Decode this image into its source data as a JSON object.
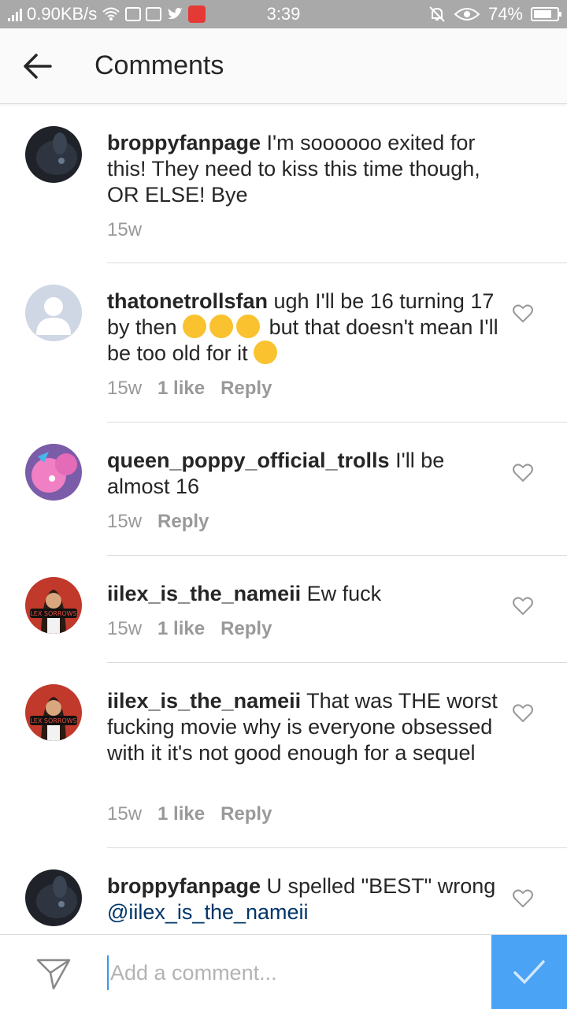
{
  "status_bar": {
    "speed": "0.90KB/s",
    "time": "3:39",
    "battery": "74%"
  },
  "header": {
    "title": "Comments"
  },
  "comments": [
    {
      "username": "broppyfanpage",
      "text": " I'm soooooo exited for this! They need to kiss this time though, OR ELSE! Bye",
      "age": "15w",
      "likes": "",
      "reply": ""
    },
    {
      "username": "thatonetrollsfan",
      "text_a": " ugh I'll be 16 turning 17 by then ",
      "text_b": " but that doesn't mean I'll be too old for it ",
      "age": "15w",
      "likes": "1 like",
      "reply": "Reply"
    },
    {
      "username": "queen_poppy_official_trolls",
      "text": " I'll be almost 16",
      "age": "15w",
      "reply": "Reply"
    },
    {
      "username": "iilex_is_the_nameii",
      "text": " Ew fuck",
      "age": "15w",
      "likes": "1 like",
      "reply": "Reply"
    },
    {
      "username": "iilex_is_the_nameii",
      "text": " That was THE worst fucking movie why is everyone obsessed with it it's not good enough for a sequel",
      "age": "15w",
      "likes": "1 like",
      "reply": "Reply"
    },
    {
      "username": "broppyfanpage",
      "text": " U spelled \"BEST\" wrong ",
      "mention": "@iilex_is_the_nameii"
    }
  ],
  "avatar_art": {
    "lex_label": "LEX SORROWS"
  },
  "composer": {
    "placeholder": "Add a comment..."
  },
  "colors": {
    "accent": "#4aa3f4",
    "status_bar": "#a9a9a9",
    "meta_text": "#999999",
    "mention": "#003569"
  }
}
